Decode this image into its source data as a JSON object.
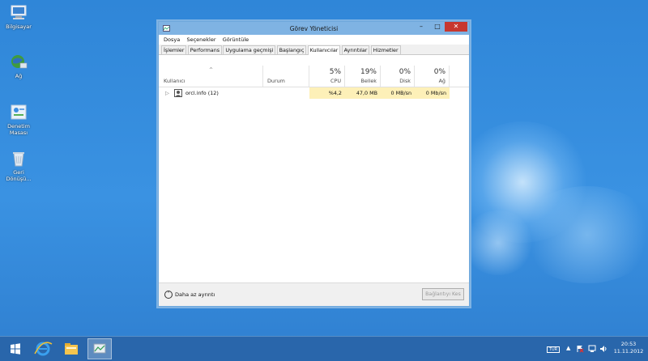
{
  "desktop": {
    "icons": [
      {
        "label": "Bilgisayar",
        "icon": "computer-icon"
      },
      {
        "label": "Ağ",
        "icon": "network-icon"
      },
      {
        "label_line1": "Denetim",
        "label_line2": "Masası",
        "icon": "control-panel-icon"
      },
      {
        "label_line1": "Geri",
        "label_line2": "Dönüşü...",
        "icon": "recycle-bin-icon"
      }
    ]
  },
  "window": {
    "title": "Görev Yöneticisi",
    "menu": [
      "Dosya",
      "Seçenekler",
      "Görüntüle"
    ],
    "tabs": [
      "İşlemler",
      "Performans",
      "Uygulama geçmişi",
      "Başlangıç",
      "Kullanıcılar",
      "Ayrıntılar",
      "Hizmetler"
    ],
    "active_tab": "Kullanıcılar",
    "columns": {
      "user": "Kullanıcı",
      "status": "Durum",
      "cpu": {
        "pct": "5%",
        "label": "CPU"
      },
      "memory": {
        "pct": "19%",
        "label": "Bellek"
      },
      "disk": {
        "pct": "0%",
        "label": "Disk"
      },
      "network": {
        "pct": "0%",
        "label": "Ağ"
      }
    },
    "rows": [
      {
        "user": "orcl.info (12)",
        "status": "",
        "cpu": "%4,2",
        "memory": "47,0 MB",
        "disk": "0 MB/sn",
        "network": "0 Mb/sn"
      }
    ],
    "footer": {
      "fewer_details": "Daha az ayrıntı",
      "disconnect": "Bağlantıyı Kes"
    }
  },
  "taskbar": {
    "clock_time": "20:53",
    "clock_date": "11.11.2012",
    "keyboard": "TUR"
  },
  "colors": {
    "desktop": "#3a8ee0",
    "titlebar": "#7fb3e3",
    "highlight": "#fdf0b8",
    "close": "#c7372f"
  }
}
